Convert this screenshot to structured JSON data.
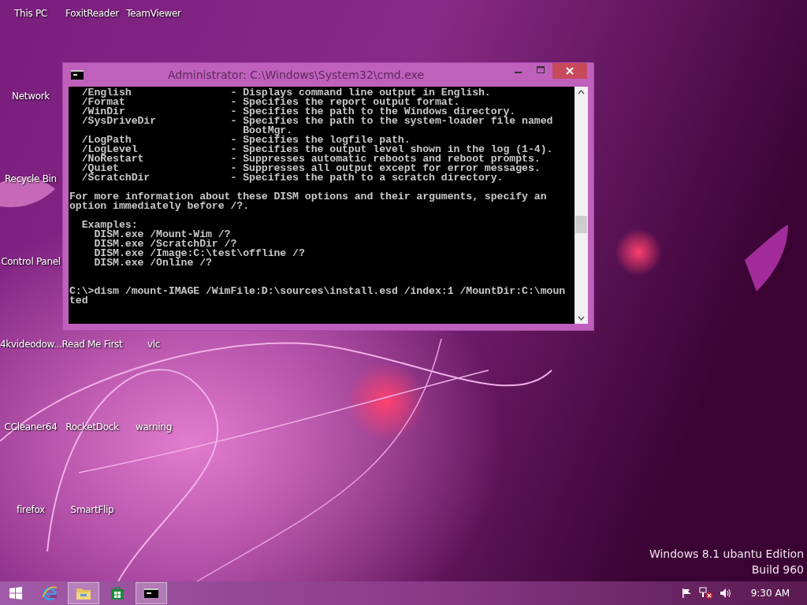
{
  "desktop_icon_rows": [
    [
      "This PC",
      "FoxitReader",
      "TeamViewer"
    ],
    [
      "Network"
    ],
    [
      "Recycle Bin"
    ],
    [
      "Control Panel"
    ],
    [
      "4kvideodow...",
      "Read Me First",
      "vlc"
    ],
    [
      "CCleaner64",
      "RocketDock",
      "warning"
    ],
    [
      "firefox",
      "SmartFlip"
    ]
  ],
  "window": {
    "title": "Administrator: C:\\Windows\\System32\\cmd.exe",
    "console_blocks": [
      {
        "kind": "options",
        "lines": [
          "  /English                - Displays command line output in English.",
          "  /Format                 - Specifies the report output format.",
          "  /WinDir                 - Specifies the path to the Windows directory.",
          "  /SysDriveDir            - Specifies the path to the system-loader file named",
          "                            BootMgr.",
          "  /LogPath                - Specifies the logfile path.",
          "  /LogLevel               - Specifies the output level shown in the log (1-4).",
          "  /NoRestart              - Suppresses automatic reboots and reboot prompts.",
          "  /Quiet                  - Suppresses all output except for error messages.",
          "  /ScratchDir             - Specifies the path to a scratch directory."
        ]
      },
      {
        "kind": "note",
        "lines": [
          "For more information about these DISM options and their arguments, specify an",
          "option immediately before /?."
        ]
      },
      {
        "kind": "examples",
        "lines": [
          "  Examples:",
          "    DISM.exe /Mount-Wim /?",
          "    DISM.exe /ScratchDir /?",
          "    DISM.exe /Image:C:\\test\\offline /?",
          "    DISM.exe /Online /?"
        ]
      },
      {
        "kind": "command",
        "lines": [
          "C:\\>dism /mount-IMAGE /WimFile:D:\\sources\\install.esd /index:1 /MountDir:C:\\moun",
          "ted"
        ]
      }
    ]
  },
  "edition_text": "Windows 8.1 ubantu Edition",
  "build_text": "Build 960",
  "taskbar": {
    "items": [
      {
        "kind": "start",
        "selected": false
      },
      {
        "kind": "browser",
        "selected": false
      },
      {
        "kind": "folder",
        "selected": true
      },
      {
        "kind": "store",
        "selected": false
      },
      {
        "kind": "console",
        "selected": true
      }
    ],
    "time": "9:30 AM"
  }
}
